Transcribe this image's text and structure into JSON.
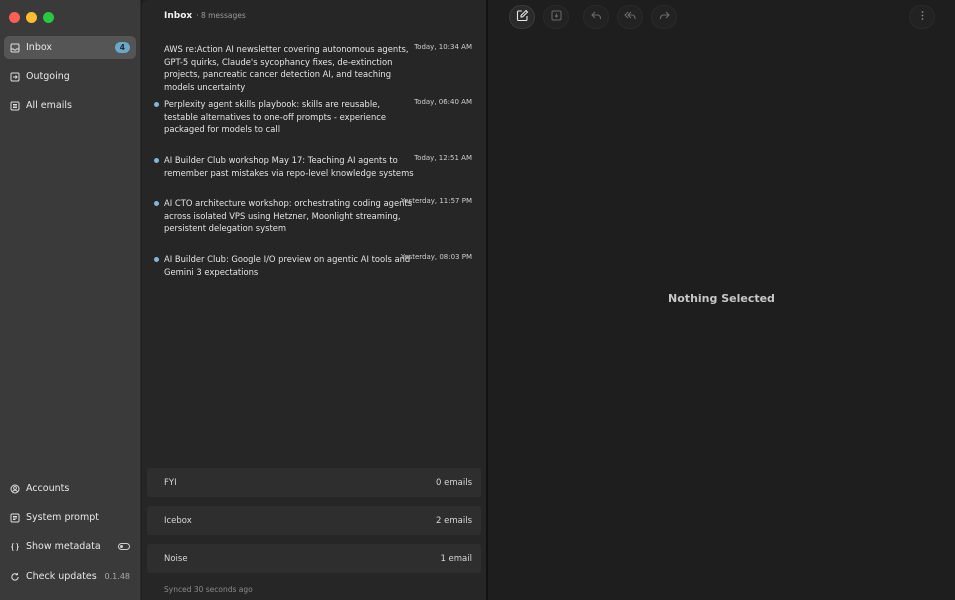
{
  "sidebar": {
    "window_controls": [
      "close",
      "minimize",
      "zoom"
    ],
    "nav": [
      {
        "label": "Inbox",
        "icon": "inbox-icon",
        "badge": "4",
        "active": true
      },
      {
        "label": "Outgoing",
        "icon": "outgoing-icon"
      },
      {
        "label": "All emails",
        "icon": "all-emails-icon"
      }
    ],
    "bottom": {
      "accounts": "Accounts",
      "system_prompt": "System prompt",
      "show_metadata": "Show metadata",
      "check_updates": "Check updates",
      "version": "0.1.48"
    }
  },
  "list": {
    "title": "Inbox",
    "count": "· 8 messages",
    "messages": [
      {
        "subject": "AWS re:Action AI newsletter covering autonomous agents, GPT-5 quirks, Claude's sycophancy fixes, de-extinction projects, pancreatic cancer detection AI, and teaching models uncertainty",
        "time": "Today, 10:34 AM",
        "unread": false
      },
      {
        "subject": "Perplexity agent skills playbook: skills are reusable, testable alternatives to one-off prompts - experience packaged for models to call",
        "time": "Today, 06:40 AM",
        "unread": true
      },
      {
        "subject": "AI Builder Club workshop May 17: Teaching AI agents to remember past mistakes via repo-level knowledge systems",
        "time": "Today, 12:51 AM",
        "unread": true
      },
      {
        "subject": "AI CTO architecture workshop: orchestrating coding agents across isolated VPS using Hetzner, Moonlight streaming, persistent delegation system",
        "time": "Yesterday, 11:57 PM",
        "unread": true
      },
      {
        "subject": "AI Builder Club: Google I/O preview on agentic AI tools and Gemini 3 expectations",
        "time": "Yesterday, 08:03 PM",
        "unread": true
      }
    ],
    "categories": [
      {
        "name": "FYI",
        "count": "0 emails"
      },
      {
        "name": "Icebox",
        "count": "2 emails"
      },
      {
        "name": "Noise",
        "count": "1 email"
      }
    ],
    "synced": "Synced 30 seconds ago"
  },
  "reading": {
    "toolbar": [
      "compose-icon",
      "archive-icon",
      "reply-icon",
      "reply-all-icon",
      "forward-icon",
      "more-icon"
    ],
    "empty_text": "Nothing Selected"
  },
  "colors": {
    "accent": "#7fb8dc",
    "badge": "#6aa7c9",
    "sidebar": "#3a3a3a",
    "list": "#262626",
    "reading": "#1e1e1e"
  }
}
